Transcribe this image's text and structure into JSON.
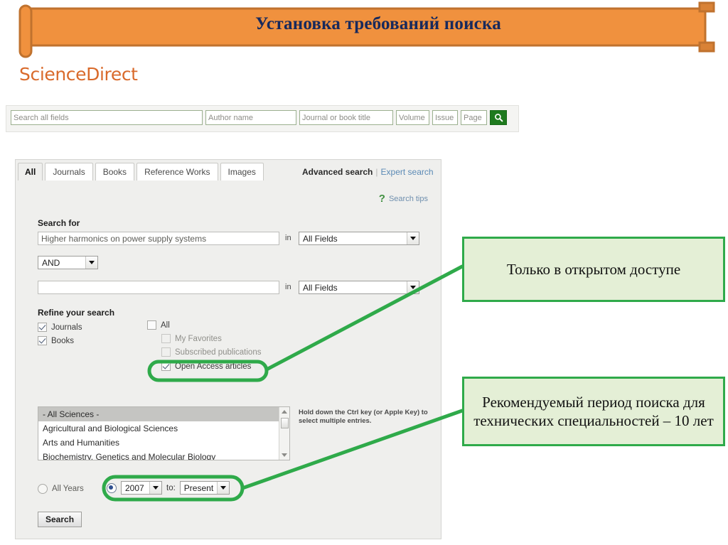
{
  "slide": {
    "title": "Установка требований поиска",
    "banner_color": "#f0913e",
    "banner_border": "#c0722e",
    "title_color": "#17295c"
  },
  "brand": {
    "logo_text": "ScienceDirect",
    "logo_color": "#d96a2b"
  },
  "quick_search": {
    "fields": [
      {
        "name": "search-all-fields-input",
        "placeholder": "Search all fields",
        "value": ""
      },
      {
        "name": "author-name-input",
        "placeholder": "Author name",
        "value": ""
      },
      {
        "name": "journal-or-book-title-input",
        "placeholder": "Journal or book title",
        "value": ""
      },
      {
        "name": "volume-input",
        "placeholder": "Volume",
        "value": ""
      },
      {
        "name": "issue-input",
        "placeholder": "Issue",
        "value": ""
      },
      {
        "name": "page-input",
        "placeholder": "Page",
        "value": ""
      }
    ],
    "go_icon": "search-icon",
    "go_button_color": "#1e7a1e"
  },
  "panel": {
    "tabs": [
      {
        "label": "All",
        "active": true
      },
      {
        "label": "Journals",
        "active": false
      },
      {
        "label": "Books",
        "active": false
      },
      {
        "label": "Reference Works",
        "active": false
      },
      {
        "label": "Images",
        "active": false
      }
    ],
    "advanced_search_label": "Advanced search",
    "separator": "|",
    "expert_search_label": "Expert search",
    "search_tips": {
      "icon": "question-mark-icon",
      "label": "Search tips"
    },
    "search_for_label": "Search for",
    "term1_value": "Higher harmonics on power supply systems",
    "term1_placeholder": "",
    "in_label": "in",
    "field1_selected": "All Fields",
    "boolean_selected": "AND",
    "term2_value": "",
    "term2_placeholder": "",
    "field2_selected": "All Fields",
    "refine_label": "Refine your search",
    "content_types": [
      {
        "label": "Journals",
        "checked": true,
        "dim": false
      },
      {
        "label": "Books",
        "checked": true,
        "dim": false
      }
    ],
    "access_filters": [
      {
        "label": "All",
        "checked": false,
        "dim": false
      },
      {
        "label": "My Favorites",
        "checked": false,
        "dim": true
      },
      {
        "label": "Subscribed publications",
        "checked": false,
        "dim": true
      },
      {
        "label": "Open Access articles",
        "checked": true,
        "dim": false
      }
    ],
    "subjects": [
      {
        "label": "- All Sciences -",
        "selected": true
      },
      {
        "label": "Agricultural and Biological Sciences",
        "selected": false
      },
      {
        "label": "Arts and Humanities",
        "selected": false
      },
      {
        "label": "Biochemistry, Genetics and Molecular Biology",
        "selected": false
      }
    ],
    "ctrl_hint": "Hold down the Ctrl key (or Apple Key) to select multiple entries.",
    "all_years_label": "All Years",
    "all_years_selected": false,
    "range_selected": true,
    "year_from": "2007",
    "to_label": "to:",
    "year_to": "Present",
    "search_button_label": "Search"
  },
  "annotations": {
    "accent_color": "#2faa4a",
    "fill_color": "#e4efd6",
    "callouts": [
      {
        "text": "Только в открытом доступе",
        "targets": "open-access-articles-checkbox"
      },
      {
        "text": "Рекомендуемый период поиска для технических специальностей – 10 лет",
        "targets": "year-range-controls"
      }
    ]
  }
}
